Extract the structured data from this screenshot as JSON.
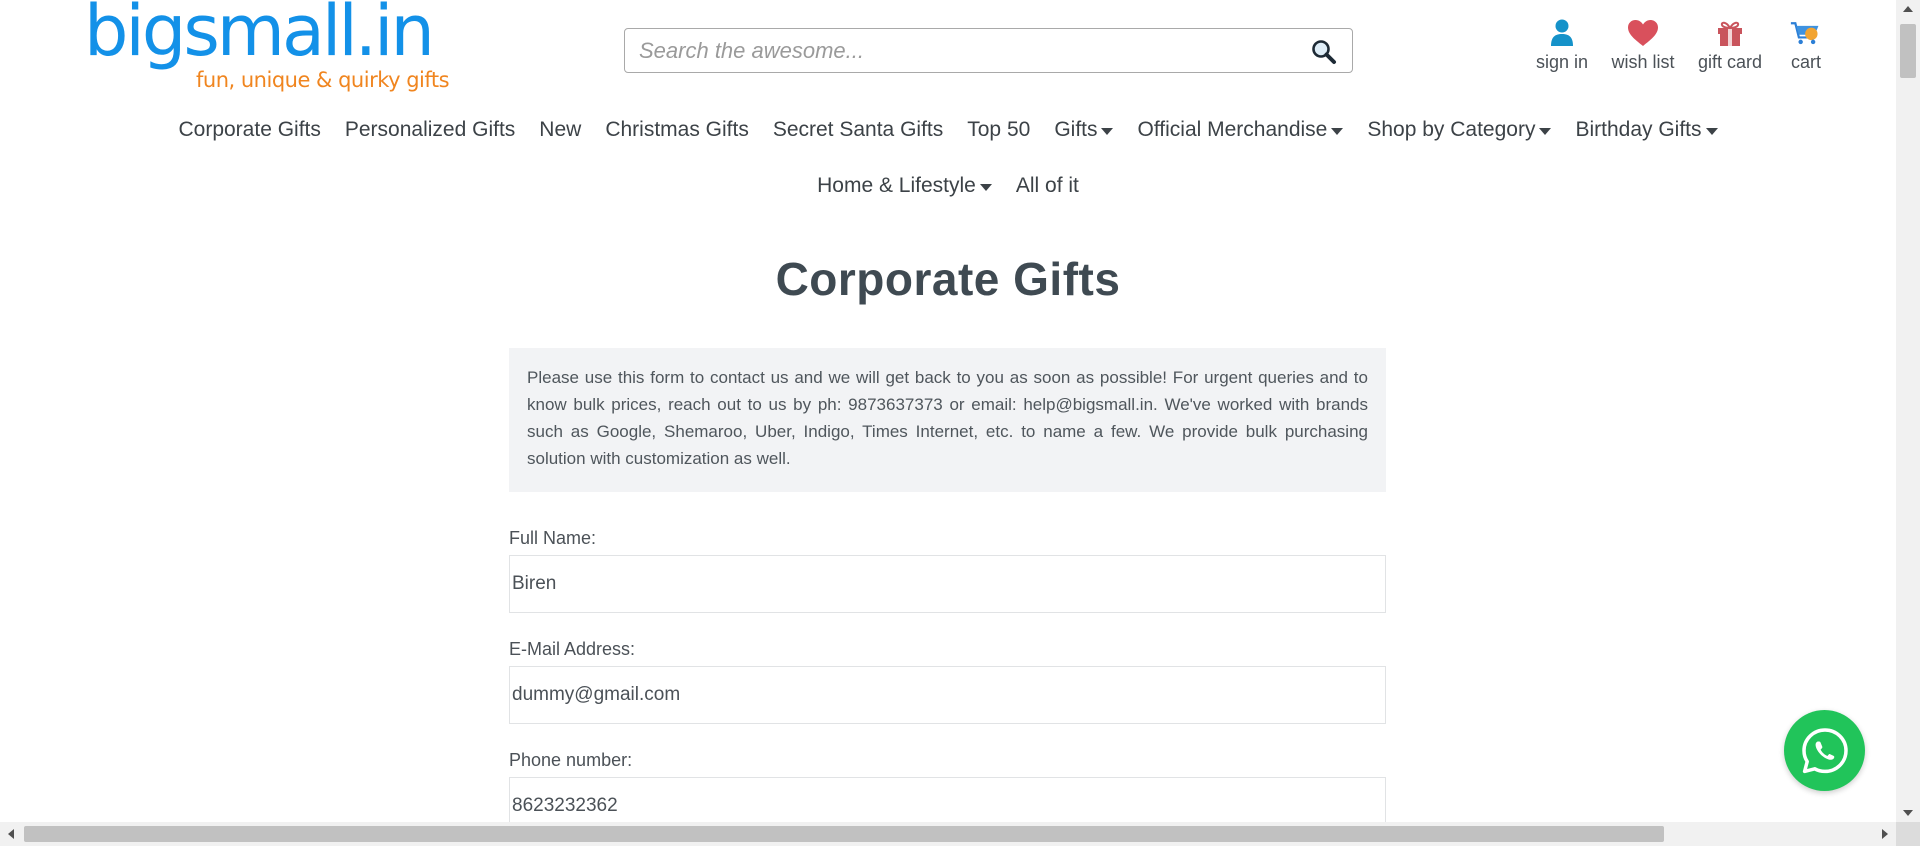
{
  "colors": {
    "brand_blue": "#1391e8",
    "brand_orange": "#f0851f",
    "whatsapp_green": "#21c45a",
    "info_box_bg": "#f2f3f5"
  },
  "header": {
    "logo_text": "bigsmall.in",
    "logo_tagline": "fun, unique & quirky gifts",
    "search": {
      "placeholder": "Search the awesome...",
      "value": "",
      "icon": "search-icon"
    },
    "actions": [
      {
        "label": "sign in",
        "icon": "user-icon"
      },
      {
        "label": "wish list",
        "icon": "heart-icon"
      },
      {
        "label": "gift card",
        "icon": "gift-icon"
      },
      {
        "label": "cart",
        "icon": "cart-icon"
      }
    ]
  },
  "nav": {
    "row1": [
      {
        "label": "Corporate Gifts",
        "dropdown": false
      },
      {
        "label": "Personalized Gifts",
        "dropdown": false
      },
      {
        "label": "New",
        "dropdown": false
      },
      {
        "label": "Christmas Gifts",
        "dropdown": false
      },
      {
        "label": "Secret Santa Gifts",
        "dropdown": false
      },
      {
        "label": "Top 50",
        "dropdown": false
      },
      {
        "label": "Gifts",
        "dropdown": true
      },
      {
        "label": "Official Merchandise",
        "dropdown": true
      },
      {
        "label": "Shop by Category",
        "dropdown": true
      },
      {
        "label": "Birthday Gifts",
        "dropdown": true
      }
    ],
    "row2": [
      {
        "label": "Home & Lifestyle",
        "dropdown": true
      },
      {
        "label": "All of it",
        "dropdown": false
      }
    ]
  },
  "main": {
    "title": "Corporate Gifts",
    "info_text": "Please use this form to contact us and we will get back to you as soon as possible! For urgent queries and to know bulk prices, reach out to us by ph: 9873637373 or email: help@bigsmall.in. We've worked with brands such as Google, Shemaroo, Uber, Indigo, Times Internet, etc. to name a few. We provide bulk purchasing solution with customization as well.",
    "form": {
      "full_name": {
        "label": "Full Name:",
        "value": "Biren"
      },
      "email": {
        "label": "E-Mail Address:",
        "value": "dummy@gmail.com"
      },
      "phone": {
        "label": "Phone number:",
        "value": "8623232362"
      }
    }
  },
  "whatsapp": {
    "icon": "whatsapp-icon"
  }
}
